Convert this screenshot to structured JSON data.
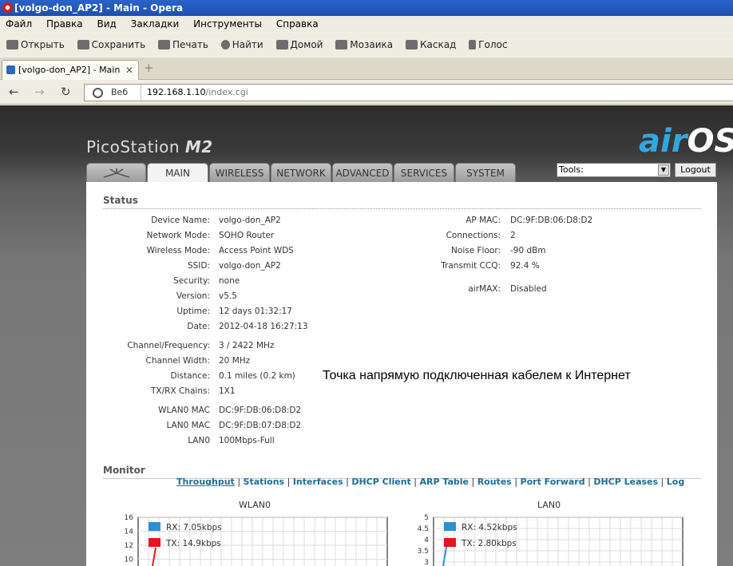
{
  "window": {
    "title": "[volgo-don_AP2] - Main - Opera"
  },
  "menu": [
    "Файл",
    "Правка",
    "Вид",
    "Закладки",
    "Инструменты",
    "Справка"
  ],
  "toolbar": {
    "open": "Открыть",
    "save": "Сохранить",
    "print": "Печать",
    "find": "Найти",
    "home": "Домой",
    "tile": "Мозаика",
    "cascade": "Каскад",
    "voice": "Голос"
  },
  "tab": {
    "label": "[volgo-don_AP2] - Main"
  },
  "address": {
    "web_label": "Веб",
    "host": "192.168.1.10",
    "path": "/index.cgi"
  },
  "page": {
    "product": "PicoStation",
    "product_model": "M2",
    "brand_air": "air",
    "brand_os": "OS",
    "brand_tm": "™",
    "nav_tabs": [
      "MAIN",
      "WIRELESS",
      "NETWORK",
      "ADVANCED",
      "SERVICES",
      "SYSTEM"
    ],
    "tools_label": "Tools:",
    "logout_label": "Logout",
    "status_title": "Status",
    "status_left": [
      {
        "k": "Device Name:",
        "v": "volgo-don_AP2"
      },
      {
        "k": "Network Mode:",
        "v": "SOHO Router"
      },
      {
        "k": "Wireless Mode:",
        "v": "Access Point WDS"
      },
      {
        "k": "SSID:",
        "v": "volgo-don_AP2"
      },
      {
        "k": "Security:",
        "v": "none"
      },
      {
        "k": "Version:",
        "v": "v5.5"
      },
      {
        "k": "Uptime:",
        "v": "12 days 01:32:17"
      },
      {
        "k": "Date:",
        "v": "2012-04-18 16:27:13"
      },
      {
        "k": "Channel/Frequency:",
        "v": "3 / 2422 MHz"
      },
      {
        "k": "Channel Width:",
        "v": "20 MHz"
      },
      {
        "k": "Distance:",
        "v": "0.1 miles (0.2 km)"
      },
      {
        "k": "TX/RX Chains:",
        "v": "1X1"
      },
      {
        "k": "WLAN0 MAC",
        "v": "DC:9F:DB:06:D8:D2"
      },
      {
        "k": "LAN0 MAC",
        "v": "DC:9F:DB:07:D8:D2"
      },
      {
        "k": "LAN0",
        "v": "100Mbps-Full"
      }
    ],
    "status_right": [
      {
        "k": "AP MAC:",
        "v": "DC:9F:DB:06:D8:D2"
      },
      {
        "k": "Connections:",
        "v": "2"
      },
      {
        "k": "Noise Floor:",
        "v": "-90 dBm"
      },
      {
        "k": "Transmit CCQ:",
        "v": "92.4 %"
      },
      {
        "k": "airMAX:",
        "v": "Disabled"
      }
    ],
    "note": "Точка напрямую подключенная кабелем к Интернет",
    "monitor_title": "Monitor",
    "monitor_links": [
      "Throughput",
      "Stations",
      "Interfaces",
      "DHCP Client",
      "ARP Table",
      "Routes",
      "Port Forward",
      "DHCP Leases",
      "Log"
    ],
    "monitor_active": "Throughput",
    "colors": {
      "rx": "#2d8fd1",
      "tx": "#e8151b",
      "accent": "#33a7dd"
    }
  },
  "chart_data": [
    {
      "type": "line",
      "title": "WLAN0",
      "y_ticks": [
        "16",
        "14",
        "12",
        "10"
      ],
      "ylim_visible": [
        10,
        16
      ],
      "series": [
        {
          "name": "RX: 7.05kbps",
          "color": "#2d8fd1"
        },
        {
          "name": "TX: 14.9kbps",
          "color": "#e8151b"
        }
      ],
      "grid": true,
      "legend": "top-left"
    },
    {
      "type": "line",
      "title": "LAN0",
      "y_ticks": [
        "5",
        "4.5",
        "4",
        "3.5",
        "3"
      ],
      "ylim_visible": [
        3,
        5
      ],
      "series": [
        {
          "name": "RX: 4.52kbps",
          "color": "#2d8fd1"
        },
        {
          "name": "TX: 2.80kbps",
          "color": "#e8151b"
        }
      ],
      "grid": true,
      "legend": "top-left"
    }
  ]
}
